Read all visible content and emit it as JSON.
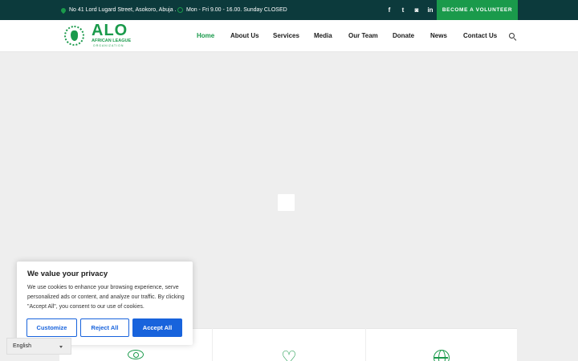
{
  "topbar": {
    "address": "No 41 Lord Lugard Street, Asokoro, Abuja .",
    "hours": "Mon - Fri 9.00 - 16.00. Sunday CLOSED",
    "social": [
      {
        "icon": "facebook-icon",
        "glyph": "f"
      },
      {
        "icon": "twitter-icon",
        "glyph": "t"
      },
      {
        "icon": "flickr-icon",
        "glyph": "◙"
      },
      {
        "icon": "linkedin-icon",
        "glyph": "in"
      }
    ],
    "volunteer_label": "BECOME A VOLUNTEER"
  },
  "logo": {
    "name": "ALO",
    "line1": "AFRICAN LEAGUE",
    "line2": "ORGANIZATION"
  },
  "nav": {
    "items": [
      {
        "label": "Home",
        "active": true
      },
      {
        "label": "About Us"
      },
      {
        "label": "Services"
      },
      {
        "label": "Media"
      },
      {
        "label": "Our Team"
      },
      {
        "label": "Donate"
      },
      {
        "label": "News"
      },
      {
        "label": "Contact Us"
      }
    ]
  },
  "cards": [
    {
      "icon": "eye-icon"
    },
    {
      "icon": "heart-icon"
    },
    {
      "icon": "globe-icon"
    }
  ],
  "cookie": {
    "title": "We value your privacy",
    "body": "We use cookies to enhance your browsing experience, serve personalized ads or content, and analyze our traffic. By clicking \"Accept All\", you consent to our use of cookies.",
    "customize": "Customize",
    "reject": "Reject All",
    "accept": "Accept All"
  },
  "language": {
    "selected": "English"
  },
  "colors": {
    "topbar_bg": "#0c3a3c",
    "brand_green": "#1a9a4b",
    "cookie_blue": "#1863dc",
    "page_bg": "#eeeeee"
  }
}
